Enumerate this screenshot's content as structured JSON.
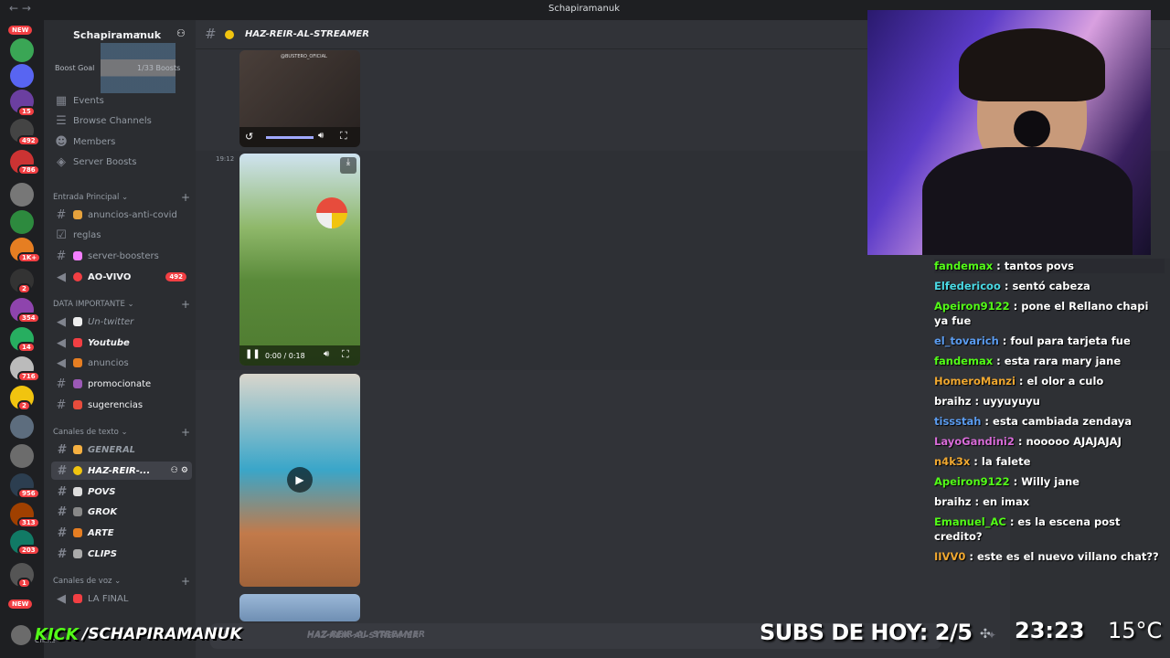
{
  "window": {
    "title": "Schapiramanuk"
  },
  "server": {
    "name": "Schapiramanuk",
    "boost_goal": "Boost Goal",
    "boost_count": "1/33 Boosts"
  },
  "guild_badges": [
    "NEW",
    "15",
    "492",
    "786",
    "1K+",
    "2",
    "354",
    "14",
    "716",
    "2",
    "956",
    "313",
    "203",
    "1",
    "NEW"
  ],
  "menu": [
    {
      "label": "Events"
    },
    {
      "label": "Browse Channels"
    },
    {
      "label": "Members"
    },
    {
      "label": "Server Boosts"
    }
  ],
  "categories": [
    {
      "label": "Entrada Principal"
    },
    {
      "label": "DATA IMPORTANTE"
    },
    {
      "label": "Canales de texto"
    },
    {
      "label": "Canales de voz"
    }
  ],
  "channels_entrada": [
    {
      "label": "anuncios-anti-covid"
    },
    {
      "label": "reglas"
    },
    {
      "label": "server-boosters"
    },
    {
      "label": "AO-VIVO",
      "badge": "492"
    }
  ],
  "channels_data": [
    {
      "label": "Un-twitter"
    },
    {
      "label": "Youtube"
    },
    {
      "label": "anuncios"
    },
    {
      "label": "promocionate"
    },
    {
      "label": "sugerencias"
    }
  ],
  "channels_texto": [
    {
      "label": "GENERAL"
    },
    {
      "label": "HAZ-REIR-..."
    },
    {
      "label": "POVS"
    },
    {
      "label": "GROK"
    },
    {
      "label": "ARTE"
    },
    {
      "label": "CLIPS"
    }
  ],
  "channels_voz": [
    {
      "label": "LA FINAL"
    }
  ],
  "channel": {
    "title": "HAZ-REIR-AL-STREAMER",
    "input_placeholder": "HAZ-REIR-AL-STREAMER"
  },
  "messages": {
    "timestamp": "19:12",
    "video1_watermark": "@BUSTERO_OFICIAL",
    "video2_time": "0:00 / 0:18"
  },
  "chat": [
    {
      "user": "fandemax",
      "color": "#53fc18",
      "text": "tantos povs"
    },
    {
      "user": "Elfedericoo",
      "color": "#4ad9e4",
      "text": "sentó cabeza"
    },
    {
      "user": "Apeiron9122",
      "color": "#53fc18",
      "text": "pone el Rellano chapi ya fue"
    },
    {
      "user": "el_tovarich",
      "color": "#5b9cf0",
      "text": "foul para tarjeta fue"
    },
    {
      "user": "fandemax",
      "color": "#53fc18",
      "text": "esta rara mary jane"
    },
    {
      "user": "HomeroManzi",
      "color": "#f0a830",
      "text": "el olor a culo"
    },
    {
      "user": "braihz",
      "color": "#ffffff",
      "text": "uyyuyuyu"
    },
    {
      "user": "tissstah",
      "color": "#5b9cf0",
      "text": "esta cambiada zendaya"
    },
    {
      "user": "LayoGandini2",
      "color": "#d86bd8",
      "text": "nooooo AJAJAJAJ"
    },
    {
      "user": "n4k3x",
      "color": "#f0a830",
      "text": "la falete"
    },
    {
      "user": "Apeiron9122",
      "color": "#53fc18",
      "text": "Willy jane"
    },
    {
      "user": "braihz",
      "color": "#ffffff",
      "text": "en imax"
    },
    {
      "user": "Emanuel_AC",
      "color": "#53fc18",
      "text": "es la escena post credito?"
    },
    {
      "user": "IIVV0",
      "color": "#f0a830",
      "text": "este es el nuevo villano chat??"
    }
  ],
  "overlay": {
    "kick": "KICK",
    "kick_user": "/SCHAPIRAMANUK",
    "subs": "SUBS DE HOY: 2/5",
    "time": "23:23",
    "temp": "15°C",
    "status": "Online"
  },
  "colors": {
    "kick_green": "#53fc18",
    "discord_bg": "#313338",
    "sidebar_bg": "#2b2d31",
    "badge_red": "#f23f43"
  }
}
